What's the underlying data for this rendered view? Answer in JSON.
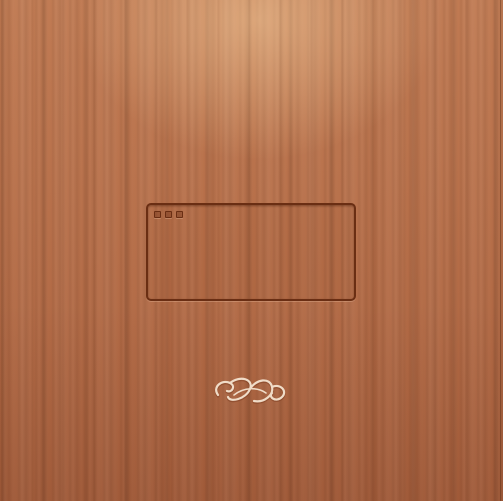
{
  "desktop": {
    "background": "wood-texture",
    "colors": {
      "wood_light": "#c07a52",
      "wood_dark": "#a85f3c",
      "frame_stroke": "#6a2e13",
      "flourish_light": "#f0dcc8",
      "flourish_shadow": "#7a3a1c"
    }
  },
  "window": {
    "controls": [
      {
        "icon": "close-icon"
      },
      {
        "icon": "minimize-icon"
      },
      {
        "icon": "maximize-icon"
      }
    ]
  },
  "logo": {
    "icon": "flourish-ornament-icon"
  }
}
